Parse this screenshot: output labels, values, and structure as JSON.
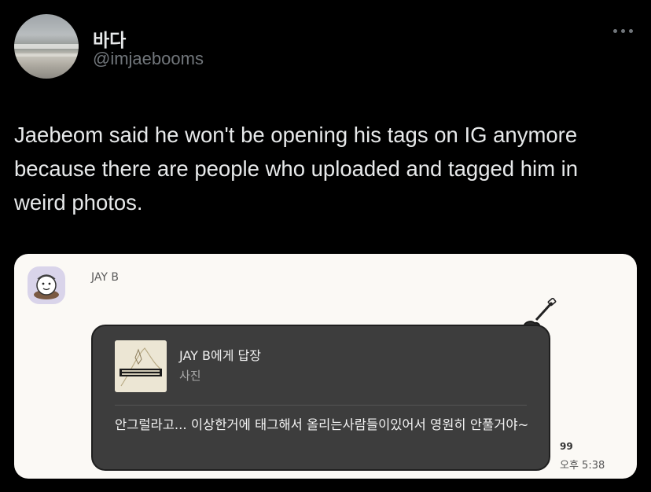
{
  "tweet": {
    "display_name": "바다",
    "handle": "@imjaebooms",
    "text": "Jaebeom said he won't be opening his tags on IG anymore because there are people who uploaded and tagged him in weird photos."
  },
  "chat": {
    "sender": "JAY B",
    "reply_to": "JAY B에게 답장",
    "reply_type": "사진",
    "message": "안그럴라고... 이상한거에 태그해서 올리는사람들이있어서 영원히 안풀거야~",
    "unread_count": "99",
    "timestamp": "오후 5:38"
  },
  "colors": {
    "background": "#000000",
    "text_primary": "#e7e9ea",
    "text_secondary": "#71767b",
    "card_background": "#fbf9f5",
    "bubble_background": "#3d3d3d"
  },
  "icons": {
    "more": "more-dots-icon",
    "guitar": "guitar-sticker-icon"
  }
}
